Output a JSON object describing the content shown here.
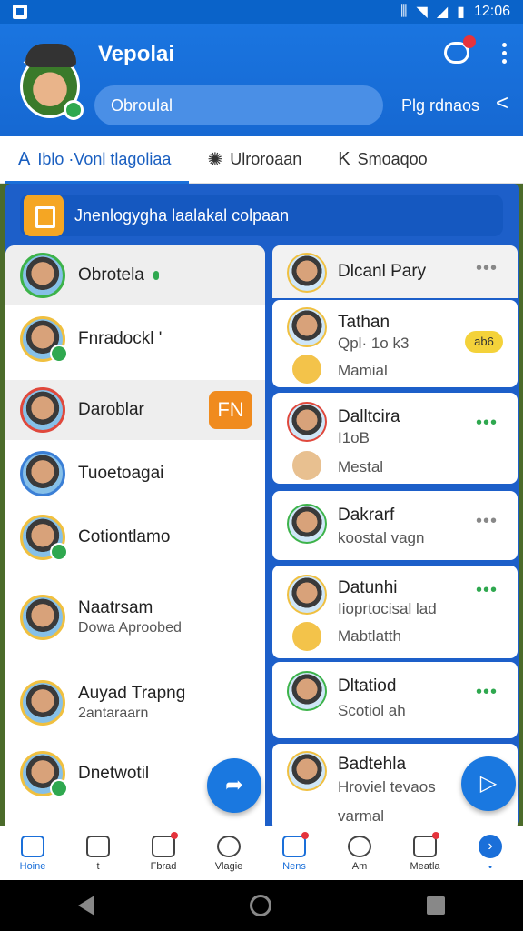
{
  "status_bar": {
    "time": "12:06"
  },
  "header": {
    "title": "Vepolai",
    "search_text": "Obroulal",
    "link_text": "Plg rdnaos",
    "chevron": "<"
  },
  "tabs": [
    {
      "label": "Iblo ·Vonl tlagoliaa",
      "icon": "A"
    },
    {
      "label": "Ulroroaan",
      "icon": "✺"
    },
    {
      "label": "Smoaqoo",
      "icon": "K"
    }
  ],
  "banner": {
    "text": "Jnenlogygha laalakal colpaan"
  },
  "left_list": [
    {
      "name": "Obrotela",
      "sub": ""
    },
    {
      "name": "Fnradockl '",
      "sub": ""
    },
    {
      "name": "Daroblar",
      "sub": "",
      "badge": "FN"
    },
    {
      "name": "Tuoetoagai",
      "sub": ""
    },
    {
      "name": "Cotiontlamo",
      "sub": ""
    },
    {
      "name": "Naatrsam",
      "sub": "Dowa Aproobed"
    },
    {
      "name": "Auyad Trapng",
      "sub": "2antaraarn"
    },
    {
      "name": "Dnetwotil",
      "sub": ""
    }
  ],
  "right_list": [
    {
      "name": "Dlcanl Pary",
      "sub": "",
      "sub2": ""
    },
    {
      "name": "Tathan",
      "sub": "Qpl· 1o k3",
      "sub2": "Mamial",
      "pill": "ab6"
    },
    {
      "name": "Dalltcira",
      "sub": "I1oB",
      "sub2": "Mestal"
    },
    {
      "name": "Dakrarf",
      "sub": "koostal vagn",
      "sub2": ""
    },
    {
      "name": "Datunhi",
      "sub": "Iioprtocisal lad",
      "sub2": "Mabtlatth"
    },
    {
      "name": "Dltatiod",
      "sub": "Scotiol ah",
      "sub2": ""
    },
    {
      "name": "Badtehla",
      "sub": "Hroviel tevaos",
      "sub2": "varmal"
    }
  ],
  "bottom_nav": [
    {
      "label": "Hoine",
      "icon": "home-icon"
    },
    {
      "label": "t",
      "icon": "list-icon"
    },
    {
      "label": "Fbrad",
      "icon": "inbox-icon"
    },
    {
      "label": "Vlagie",
      "icon": "gear-icon"
    },
    {
      "label": "Nens",
      "icon": "bell-icon"
    },
    {
      "label": "Am",
      "icon": "face-icon"
    },
    {
      "label": "Meatla",
      "icon": "person-icon"
    },
    {
      "label": "•",
      "icon": "forward-icon"
    }
  ],
  "colors": {
    "primary": "#1a6fd9",
    "accent_orange": "#f08b1e",
    "online_green": "#2fa84f"
  }
}
